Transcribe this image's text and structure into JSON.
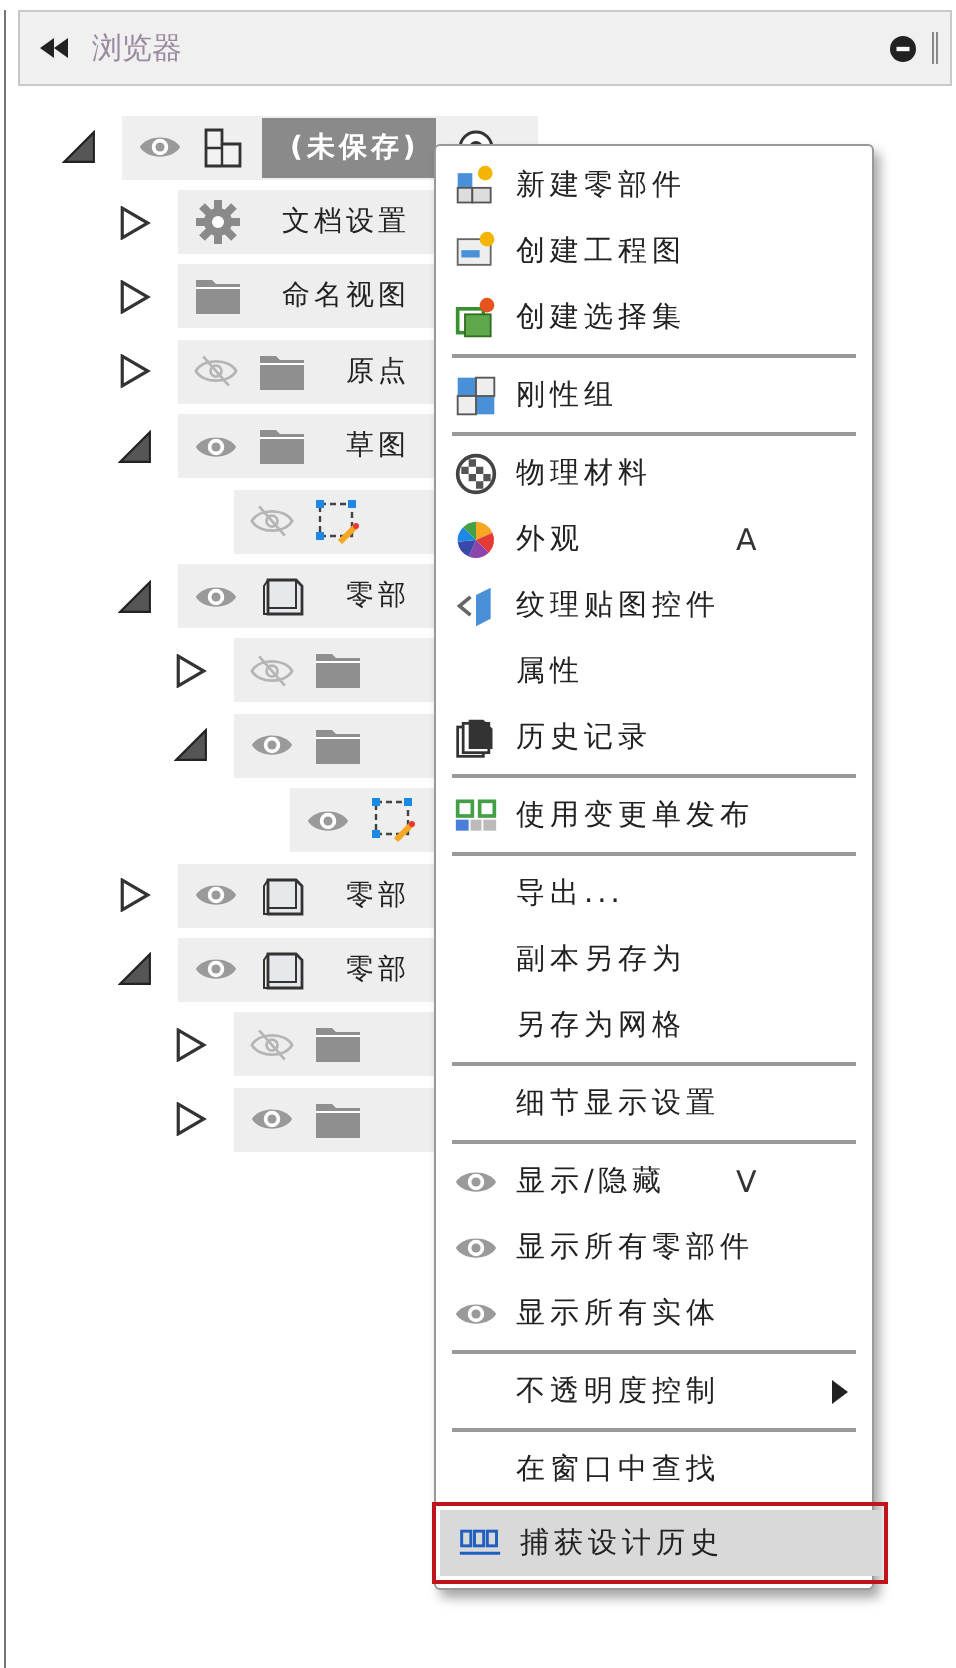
{
  "panel": {
    "title": "浏览器"
  },
  "tree": {
    "kind": "component",
    "label": "(未保存)",
    "visible": true,
    "expanded": true,
    "selected": true,
    "children": [
      {
        "kind": "settings",
        "label": "文档设置",
        "expanded": false,
        "selected": false
      },
      {
        "kind": "folder",
        "label": "命名视图",
        "expanded": false,
        "selected": false
      },
      {
        "kind": "folder",
        "label": "原点",
        "visible": false,
        "expanded": false,
        "selected": false
      },
      {
        "kind": "folder",
        "label": "草图",
        "visible": true,
        "expanded": true,
        "selected": false,
        "children": [
          {
            "kind": "sketch",
            "visible": false,
            "selected": false
          }
        ]
      },
      {
        "kind": "body",
        "label": "零部",
        "visible": true,
        "expanded": true,
        "selected": false,
        "children": [
          {
            "kind": "folder",
            "visible": false,
            "expanded": false,
            "selected": false
          },
          {
            "kind": "folder",
            "visible": true,
            "expanded": true,
            "selected": false,
            "children": [
              {
                "kind": "sketch",
                "visible": true,
                "selected": false
              }
            ]
          }
        ]
      },
      {
        "kind": "body",
        "label": "零部",
        "visible": true,
        "expanded": false,
        "selected": false
      },
      {
        "kind": "body",
        "label": "零部",
        "visible": true,
        "expanded": true,
        "selected": false,
        "children": [
          {
            "kind": "folder",
            "visible": false,
            "expanded": false,
            "selected": false
          },
          {
            "kind": "folder",
            "visible": true,
            "expanded": false,
            "selected": false
          }
        ]
      }
    ]
  },
  "menu": [
    {
      "kind": "new-part",
      "label": "新建零部件",
      "selected": false
    },
    {
      "kind": "drawing",
      "label": "创建工程图",
      "selected": false
    },
    {
      "kind": "selection-set",
      "label": "创建选择集",
      "selected": false,
      "separator_after": true
    },
    {
      "kind": "rigid-group",
      "label": "刚性组",
      "selected": false,
      "separator_after": true
    },
    {
      "kind": "material",
      "label": "物理材料",
      "selected": false
    },
    {
      "kind": "appearance",
      "label": "外观",
      "shortcut": "A",
      "selected": false
    },
    {
      "kind": "decal",
      "label": "纹理贴图控件",
      "selected": false
    },
    {
      "kind": "plain",
      "label": "属性",
      "selected": false
    },
    {
      "kind": "history",
      "label": "历史记录",
      "selected": false,
      "separator_after": true
    },
    {
      "kind": "change-order",
      "label": "使用变更单发布",
      "selected": false,
      "separator_after": true
    },
    {
      "kind": "plain",
      "label": "导出...",
      "selected": false
    },
    {
      "kind": "plain",
      "label": "副本另存为",
      "selected": false
    },
    {
      "kind": "plain",
      "label": "另存为网格",
      "selected": false,
      "separator_after": true
    },
    {
      "kind": "plain",
      "label": "细节显示设置",
      "selected": false,
      "separator_after": true
    },
    {
      "kind": "eye",
      "label": "显示/隐藏",
      "shortcut": "V",
      "selected": false
    },
    {
      "kind": "eye",
      "label": "显示所有零部件",
      "selected": false
    },
    {
      "kind": "eye",
      "label": "显示所有实体",
      "selected": false,
      "separator_after": true
    },
    {
      "kind": "plain",
      "label": "不透明度控制",
      "submenu": true,
      "selected": false,
      "separator_after": true
    },
    {
      "kind": "plain",
      "label": "在窗口中查找",
      "selected": false
    },
    {
      "kind": "capture",
      "label": "捕获设计历史",
      "selected": true
    }
  ]
}
